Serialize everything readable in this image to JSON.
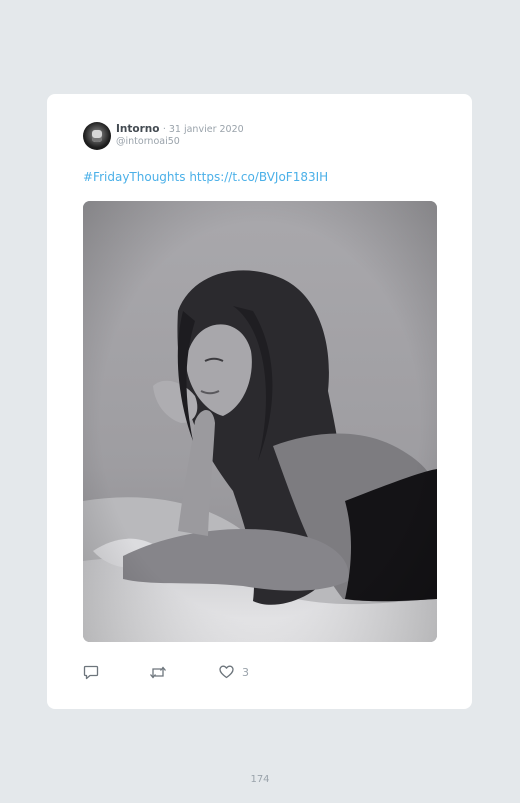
{
  "tweet": {
    "author_name": "Intorno",
    "date": "· 31 janvier 2020",
    "handle": "@intornoai50",
    "hashtag": "#FridayThoughts",
    "link": "https://t.co/BVJoF183IH",
    "likes": "3"
  },
  "icons": {
    "reply": "reply-icon",
    "retweet": "retweet-icon",
    "like": "heart-icon"
  },
  "colors": {
    "link": "#4bb0e8",
    "background": "#e4e8eb",
    "card": "#ffffff",
    "muted_text": "#9aa3ab"
  },
  "page": {
    "number": "174"
  }
}
